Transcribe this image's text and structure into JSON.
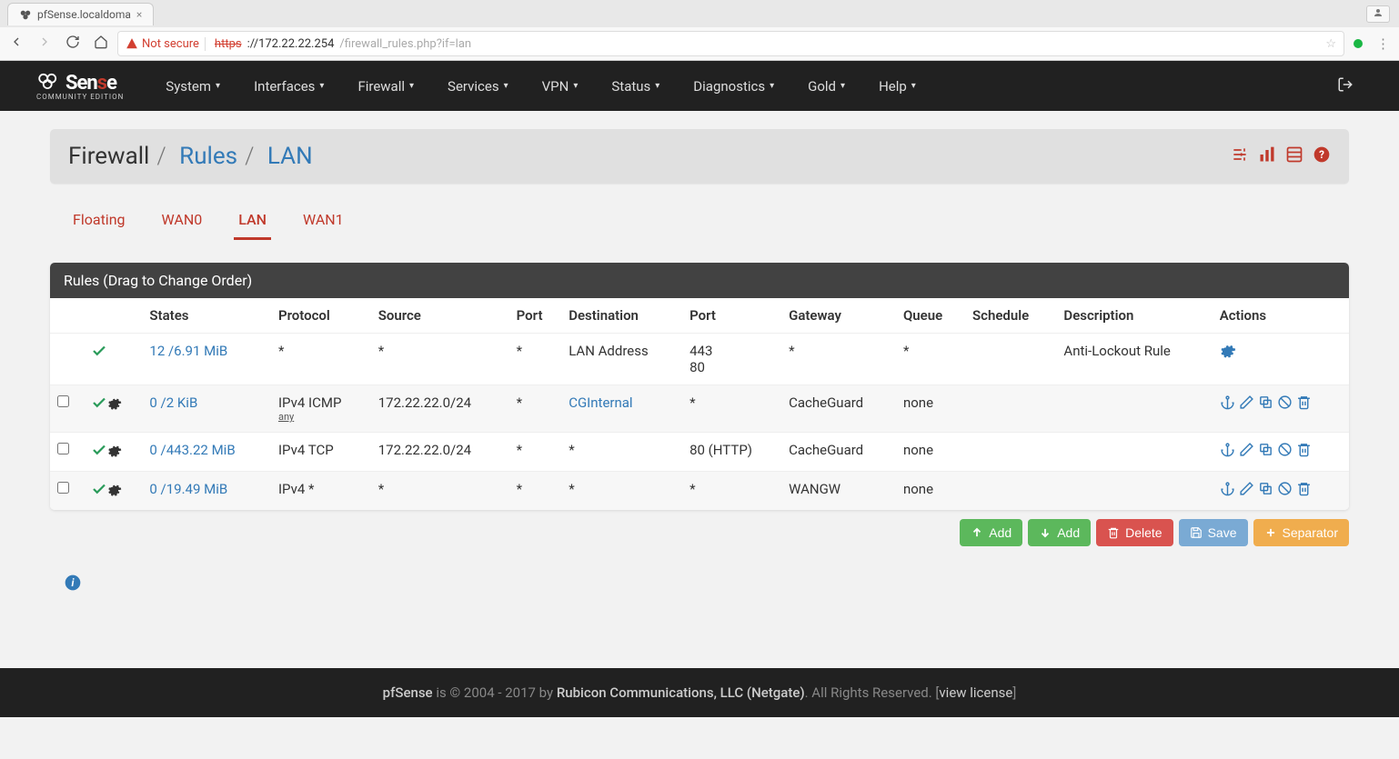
{
  "browser": {
    "tab_title": "pfSense.localdoma",
    "not_secure_label": "Not secure",
    "url_scheme": "https",
    "url_host": "://172.22.22.254",
    "url_path": "/firewall_rules.php?if=lan"
  },
  "nav": {
    "items": [
      "System",
      "Interfaces",
      "Firewall",
      "Services",
      "VPN",
      "Status",
      "Diagnostics",
      "Gold",
      "Help"
    ]
  },
  "breadcrumb": {
    "root": "Firewall",
    "mid": "Rules",
    "leaf": "LAN"
  },
  "tabs": [
    "Floating",
    "WAN0",
    "LAN",
    "WAN1"
  ],
  "active_tab": "LAN",
  "panel_title": "Rules (Drag to Change Order)",
  "table": {
    "headers": [
      "",
      "",
      "States",
      "Protocol",
      "Source",
      "Port",
      "Destination",
      "Port",
      "Gateway",
      "Queue",
      "Schedule",
      "Description",
      "Actions"
    ],
    "rows": [
      {
        "checkbox": false,
        "show_gear": false,
        "states": "12 /6.91 MiB",
        "protocol": "*",
        "protocol_sub": "",
        "source": "*",
        "sport": "*",
        "destination": "LAN Address",
        "dest_link": false,
        "dport": "443 80",
        "gateway": "*",
        "queue": "*",
        "schedule": "",
        "description": "Anti-Lockout Rule",
        "actions": "settings"
      },
      {
        "checkbox": true,
        "show_gear": true,
        "states": "0 /2 KiB",
        "protocol": "IPv4 ICMP",
        "protocol_sub": "any",
        "source": "172.22.22.0/24",
        "sport": "*",
        "destination": "CGInternal",
        "dest_link": true,
        "dport": "*",
        "gateway": "CacheGuard",
        "queue": "none",
        "schedule": "",
        "description": "",
        "actions": "full"
      },
      {
        "checkbox": true,
        "show_gear": true,
        "states": "0 /443.22 MiB",
        "protocol": "IPv4 TCP",
        "protocol_sub": "",
        "source": "172.22.22.0/24",
        "sport": "*",
        "destination": "*",
        "dest_link": false,
        "dport": "80 (HTTP)",
        "gateway": "CacheGuard",
        "queue": "none",
        "schedule": "",
        "description": "",
        "actions": "full"
      },
      {
        "checkbox": true,
        "show_gear": true,
        "states": "0 /19.49 MiB",
        "protocol": "IPv4 *",
        "protocol_sub": "",
        "source": "*",
        "sport": "*",
        "destination": "*",
        "dest_link": false,
        "dport": "*",
        "gateway": "WANGW",
        "queue": "none",
        "schedule": "",
        "description": "",
        "actions": "full"
      }
    ]
  },
  "buttons": {
    "add": "Add",
    "delete": "Delete",
    "save": "Save",
    "separator": "Separator"
  },
  "footer": {
    "brand": "pfSense",
    "copyright": " is © 2004 - 2017 by ",
    "company": "Rubicon Communications, LLC (Netgate)",
    "rights": ". All Rights Reserved. [",
    "license": "view license",
    "close": "]"
  }
}
